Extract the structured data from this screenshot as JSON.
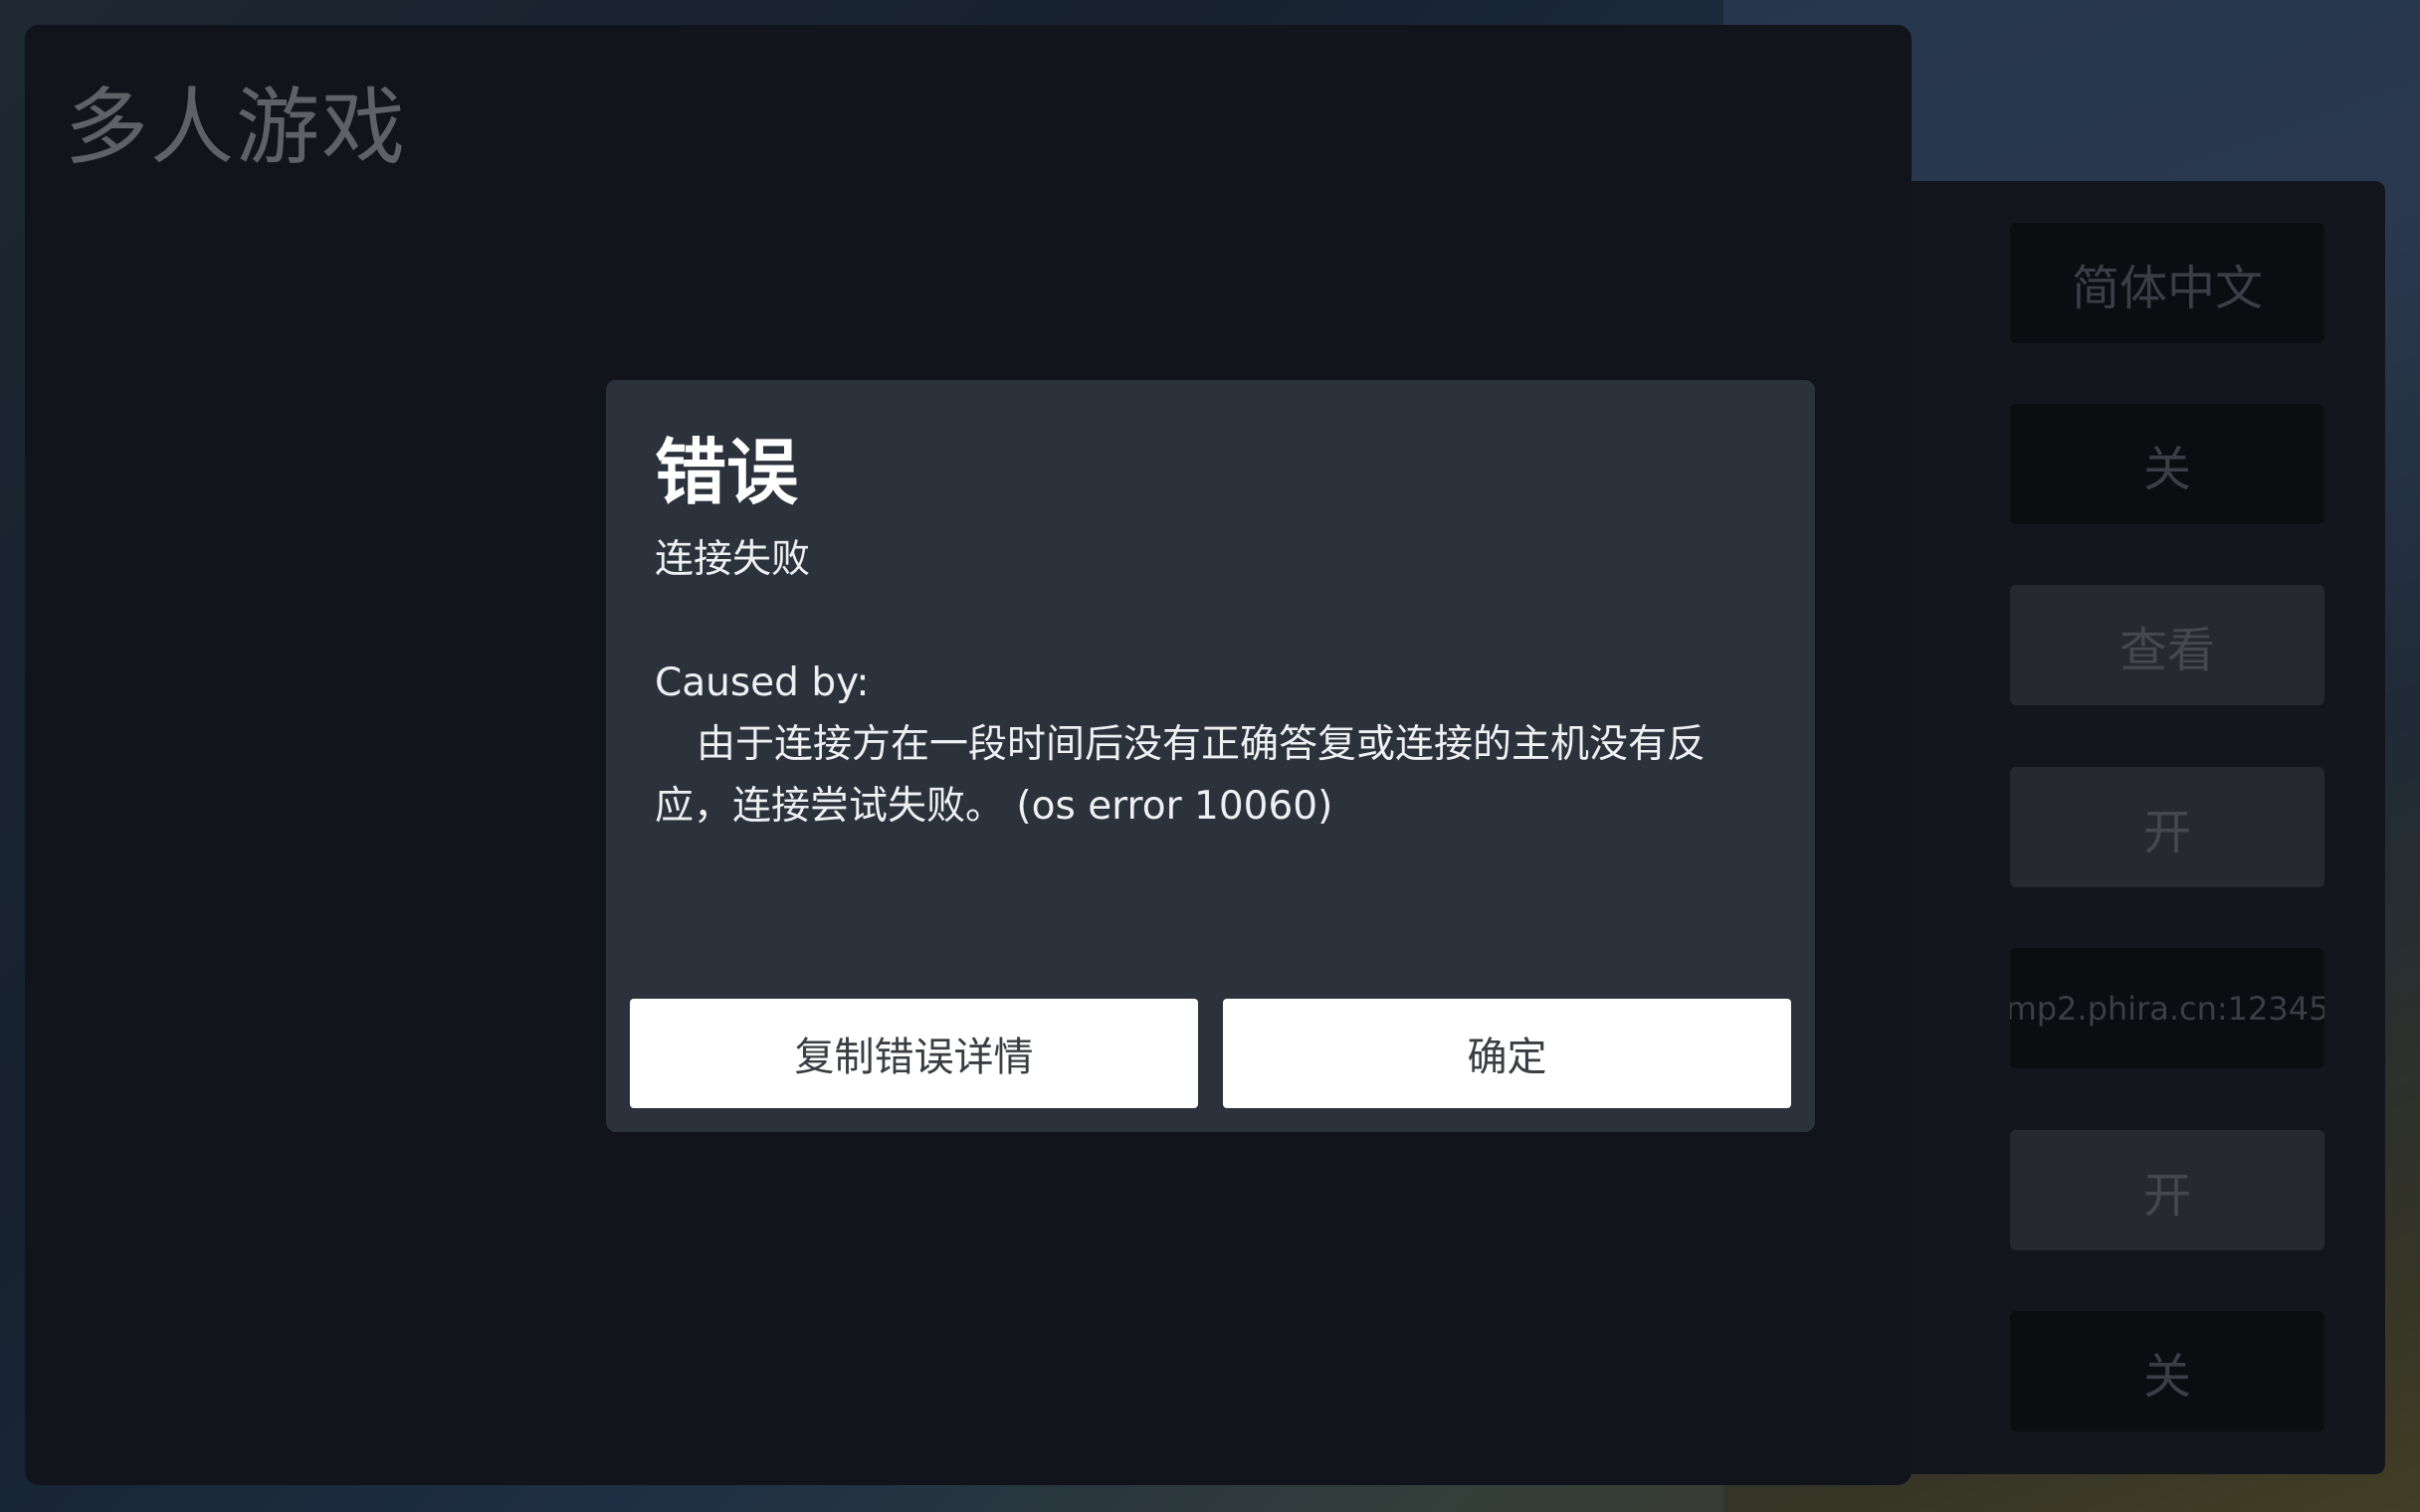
{
  "page": {
    "title": "多人游戏"
  },
  "settings": {
    "items": [
      {
        "label": "简体中文",
        "style": "dark"
      },
      {
        "label": "关",
        "style": "dark"
      },
      {
        "label": "查看",
        "style": "light"
      },
      {
        "label": "开",
        "style": "light"
      },
      {
        "label": "mp2.phira.cn:12345",
        "style": "dark"
      },
      {
        "label": "开",
        "style": "light"
      },
      {
        "label": "关",
        "style": "dark"
      }
    ]
  },
  "dialog": {
    "title": "错误",
    "message": "连接失败",
    "caused_by": "Caused by:",
    "detail": "由于连接方在一段时间后没有正确答复或连接的主机没有反应，连接尝试失败。 (os error 10060)",
    "copy_button": "复制错误详情",
    "ok_button": "确定"
  },
  "colors": {
    "panel": "#11151b",
    "dialog": "#2b323b",
    "button": "#ffffff"
  }
}
